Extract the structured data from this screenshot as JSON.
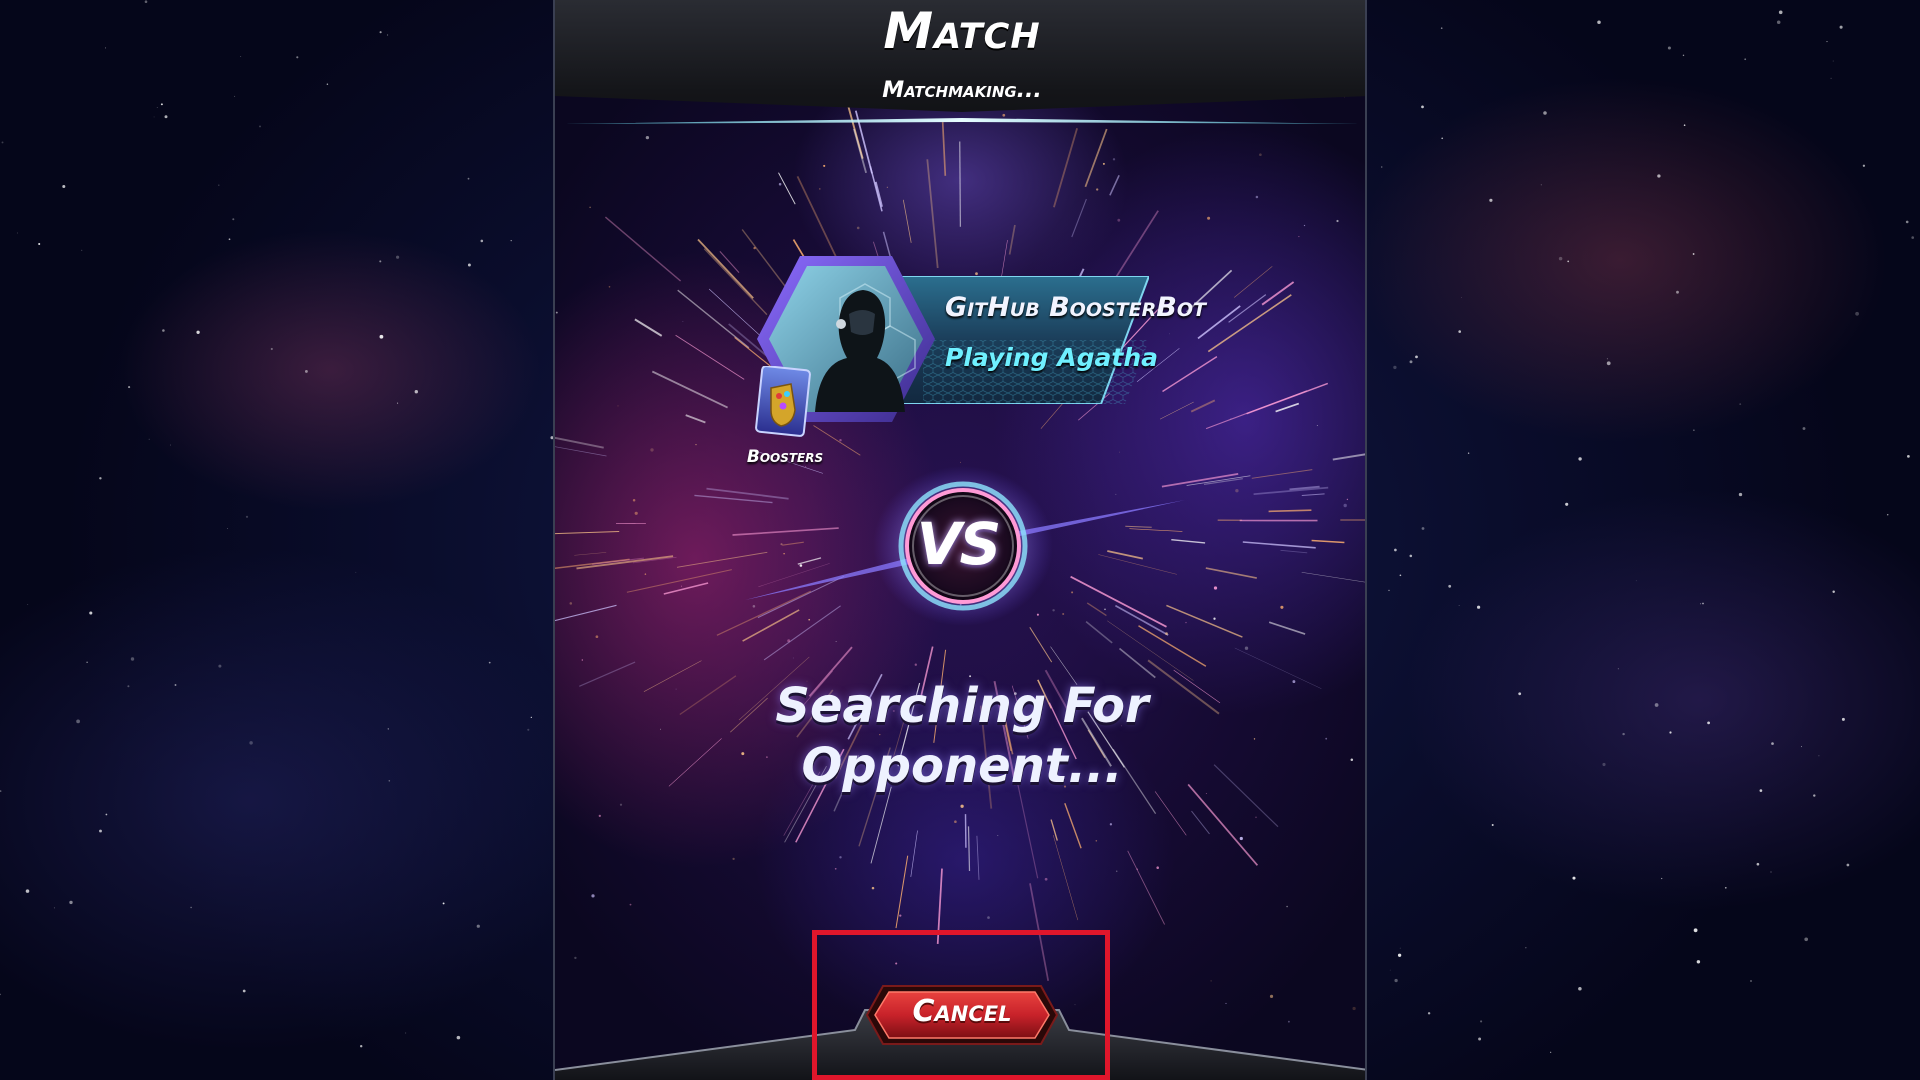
{
  "header": {
    "title": "Match",
    "subtitle": "Matchmaking..."
  },
  "player": {
    "name": "GitHub BoosterBot",
    "deck_status": "Playing Agatha",
    "boosters_label": "Boosters"
  },
  "versus": {
    "label": "VS"
  },
  "status": {
    "line1": "Searching For",
    "line2": "Opponent..."
  },
  "actions": {
    "cancel_label": "Cancel"
  },
  "colors": {
    "accent_cyan": "#6ff0ff",
    "cancel_red": "#c8222a",
    "highlight_red": "#e0162b"
  }
}
